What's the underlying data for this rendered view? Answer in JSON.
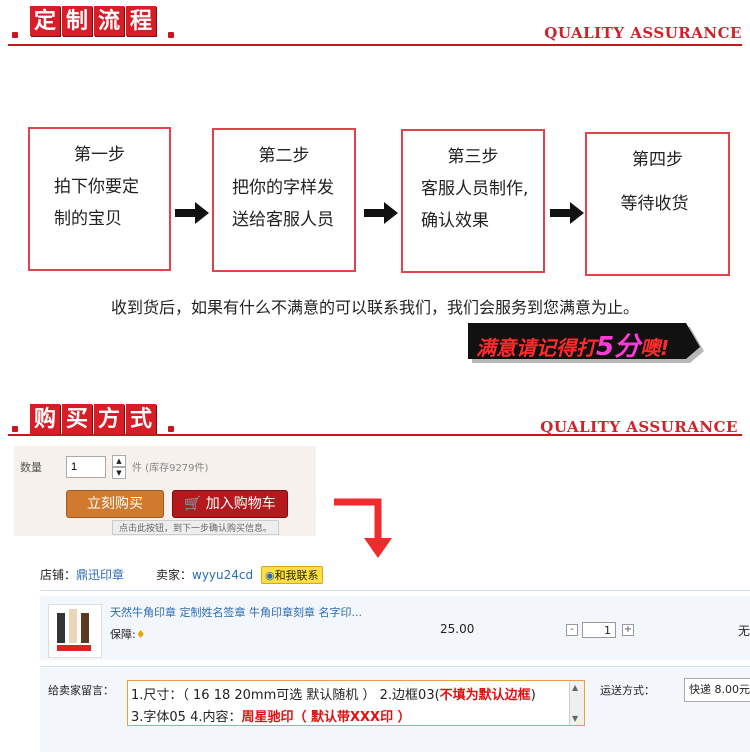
{
  "colors": {
    "accent": "#c8171e",
    "step_border": "#e0444a",
    "link": "#2c6cb0",
    "button_orange": "#d07a30",
    "button_red": "#b31a1e"
  },
  "section1": {
    "title_chars": [
      "定",
      "制",
      "流",
      "程"
    ],
    "quality": "QUALITY ASSURANCE",
    "steps": [
      {
        "title": "第一步",
        "line1": "拍下你要定",
        "line2": "制的宝贝"
      },
      {
        "title": "第二步",
        "line1": "把你的字样发",
        "line2": "送给客服人员"
      },
      {
        "title": "第三步",
        "line1": "客服人员制作,",
        "line2": "确认效果"
      },
      {
        "title": "第四步",
        "line1": "等待收货",
        "line2": ""
      }
    ],
    "note": "收到货后，如果有什么不满意的可以联系我们，我们会服务到您满意为止。",
    "stamp": {
      "pre": "满意请记得打",
      "num": "5分",
      "post": "噢!"
    }
  },
  "section2": {
    "title_chars": [
      "购",
      "买",
      "方",
      "式"
    ],
    "quality": "QUALITY ASSURANCE",
    "qty_label": "数量",
    "qty_value": "1",
    "stock": "件 (库存9279件)",
    "buy_now": "立刻购买",
    "add_cart": "加入购物车",
    "hint": "点击此按钮，到下一步确认购买信息。"
  },
  "order": {
    "shop_label": "店铺：",
    "shop_name": "鼎迅印章",
    "seller_label": "卖家：",
    "seller_name": "wyyu24cd",
    "contact": "和我联系",
    "product_title": "天然牛角印章 定制姓名签章 牛角印章刻章 名字印...",
    "guarantee": "保障:",
    "price": "25.00",
    "qty": "1",
    "minus": "-",
    "plus": "+",
    "right_cut": "无",
    "message_label": "给卖家留言：",
    "msg_line1_a": "1.尺寸：（ 16 18 20mm可选 默认随机 ） 2.边框03(",
    "msg_line1_red": "不填为默认边框",
    "msg_line1_b": ")",
    "msg_line2_a": "3.字体05    4.内容：",
    "msg_line2_red": "周星驰印（ 默认带XXX印 ）",
    "shipping_label": "运送方式：",
    "shipping_value": "快递 8.00元"
  }
}
